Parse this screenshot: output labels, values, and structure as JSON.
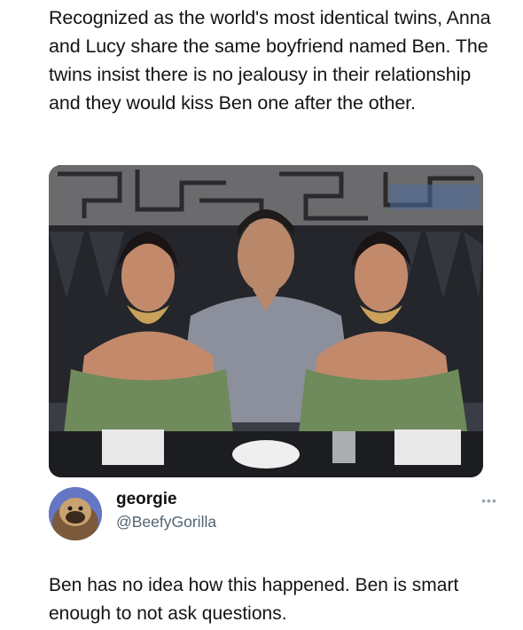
{
  "post": {
    "caption": "Recognized as the world's most identical twins, Anna and Lucy share the same boyfriend named Ben. The twins insist there is no jealousy in their relationship and they would kiss Ben one after the other."
  },
  "photo": {
    "subject": "photo-two-women-and-man-at-restaurant-table"
  },
  "author": {
    "display_name": "georgie",
    "handle": "@BeefyGorilla",
    "avatar_icon": "gorilla-avatar-icon"
  },
  "menu": {
    "more_icon": "ellipsis-icon",
    "more_glyph": "•••"
  },
  "reply": {
    "text": "Ben has no idea how this happened. Ben is smart enough to not ask questions."
  }
}
